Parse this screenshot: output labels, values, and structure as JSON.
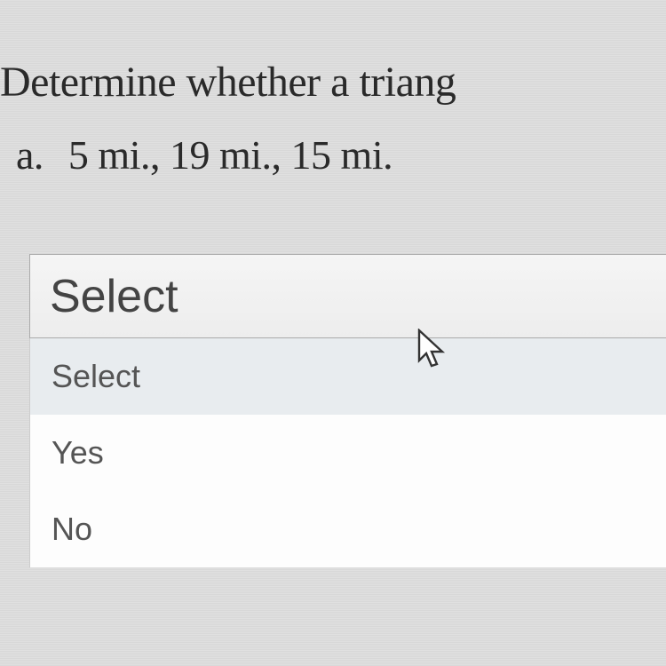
{
  "question": {
    "prompt": "Determine whether a triang",
    "sub_letter": "a.",
    "sub_text": "5 mi., 19 mi., 15 mi."
  },
  "dropdown": {
    "selected": "Select",
    "options": [
      "Select",
      "Yes",
      "No"
    ]
  }
}
